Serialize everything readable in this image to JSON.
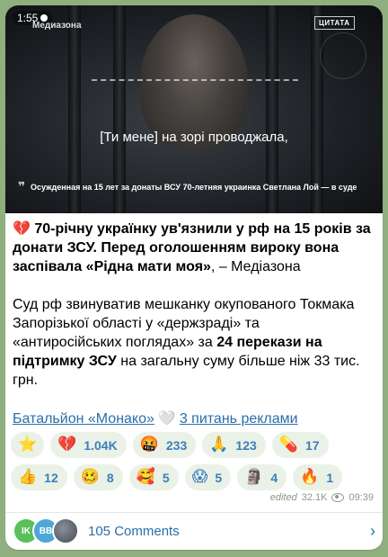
{
  "video": {
    "time": "1:55",
    "brand": "Медиазона",
    "quote_tag": "ЦИТАТА",
    "subtitle": "[Ти мене] на зорі проводжала,",
    "caption": "Осужденная на 15 лет за донаты ВСУ 70-летняя украинка Светлана Лой — в суде"
  },
  "post": {
    "headline_emoji": "💔",
    "headline_bold": "70-річну українку ув'язнили у рф на 15 років за донати ЗСУ. Перед оголошенням вироку вона заспівала «Рідна мати моя»",
    "headline_rest": ", – Медіазона",
    "body_1": "Суд рф звинуватив мешканку окупованого Токмака Запорізької області у «держзраді» та «антиросійських поглядах» за ",
    "body_bold": "24 перекази на підтримку ЗСУ",
    "body_2": " на загальну суму більше ніж 33 тис. грн."
  },
  "links": {
    "channel": "Батальйон «Монако»",
    "heart": "🤍",
    "ads": "3 питань реклами"
  },
  "reactions": {
    "row1": [
      {
        "icon": "star-icon",
        "glyph": "⭐",
        "count": ""
      },
      {
        "icon": "broken-heart-icon",
        "glyph": "💔",
        "count": "1.04K"
      },
      {
        "icon": "angry-face-icon",
        "glyph": "🤬",
        "count": "233"
      },
      {
        "icon": "praying-hands-icon",
        "glyph": "🙏",
        "count": "123"
      },
      {
        "icon": "pill-icon",
        "glyph": "💊",
        "count": "17"
      }
    ],
    "row2": [
      {
        "icon": "thumbs-up-icon",
        "glyph": "👍",
        "count": "12"
      },
      {
        "icon": "woozy-face-icon",
        "glyph": "🥴",
        "count": "8"
      },
      {
        "icon": "smiling-hearts-face-icon",
        "glyph": "🥰",
        "count": "5"
      },
      {
        "icon": "screaming-face-icon",
        "glyph": "😱",
        "count": "5"
      },
      {
        "icon": "moai-icon",
        "glyph": "🗿",
        "count": "4"
      },
      {
        "icon": "fire-icon",
        "glyph": "🔥",
        "count": "1"
      }
    ]
  },
  "meta": {
    "edited": "edited",
    "views": "32.1K",
    "time": "09:39"
  },
  "comments": {
    "avatar1": "IK",
    "avatar2": "BB",
    "label": "105 Comments",
    "chevron": "›"
  },
  "colors": {
    "background": "#8fb07e",
    "link": "#2b6eaa",
    "reaction_bg": "#eaf1e6"
  }
}
